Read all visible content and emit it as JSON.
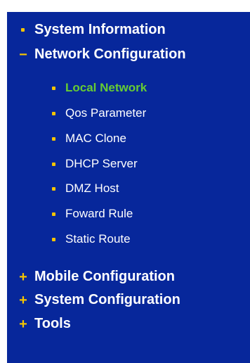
{
  "menu": {
    "system_information": {
      "label": "System Information",
      "marker": "bullet"
    },
    "network_configuration": {
      "label": "Network Configuration",
      "marker": "−",
      "expanded": true,
      "children": [
        {
          "label": "Local Network",
          "active": true
        },
        {
          "label": "Qos Parameter"
        },
        {
          "label": "MAC Clone"
        },
        {
          "label": "DHCP Server"
        },
        {
          "label": "DMZ Host"
        },
        {
          "label": "Foward Rule"
        },
        {
          "label": "Static Route"
        }
      ]
    },
    "mobile_configuration": {
      "label": "Mobile Configuration",
      "marker": "+"
    },
    "system_configuration": {
      "label": "System Configuration",
      "marker": "+"
    },
    "tools": {
      "label": "Tools",
      "marker": "+"
    }
  },
  "colors": {
    "background": "#07279b",
    "text": "#ffffff",
    "active_text": "#66cc33",
    "marker": "#f5c400"
  }
}
